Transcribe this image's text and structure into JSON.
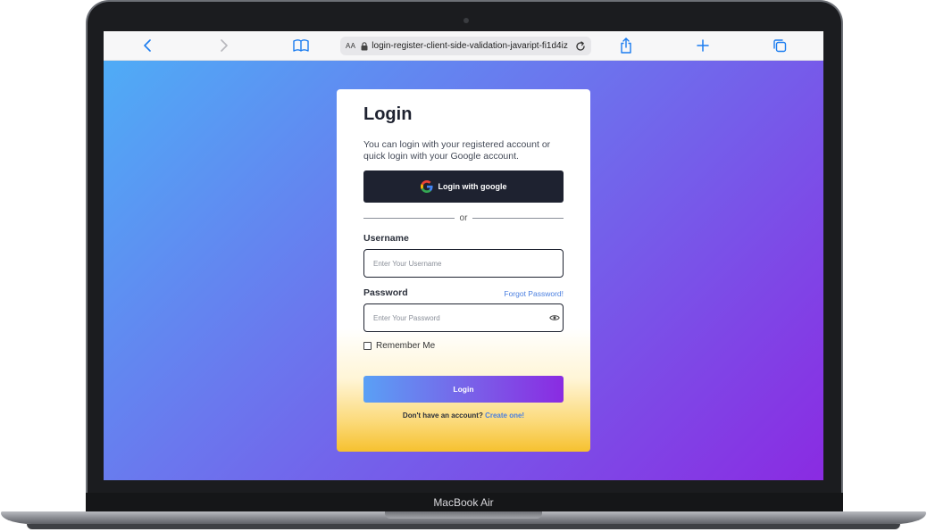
{
  "device": {
    "brand_label": "MacBook Air"
  },
  "browser": {
    "aa_label": "AA",
    "url": "login-register-client-side-validation-javaript-fi1d4iz"
  },
  "login": {
    "title": "Login",
    "description": "You can login with your registered account or quick login with your Google account.",
    "google_button_label": "Login with google",
    "divider_text": "or",
    "username_label": "Username",
    "username_placeholder": "Enter Your Username",
    "password_label": "Password",
    "forgot_password_link": "Forgot Password!",
    "password_placeholder": "Enter Your Password",
    "remember_me_label": "Remember Me",
    "login_button_label": "Login",
    "signup_prompt": "Don't have an account?",
    "signup_link": "Create one!"
  },
  "colors": {
    "accent_blue": "#4a7fe0",
    "dark_button": "#1e2230",
    "gradient_start": "#4facf6",
    "gradient_end": "#8a2be2",
    "card_bottom_yellow": "#f6c12f"
  }
}
